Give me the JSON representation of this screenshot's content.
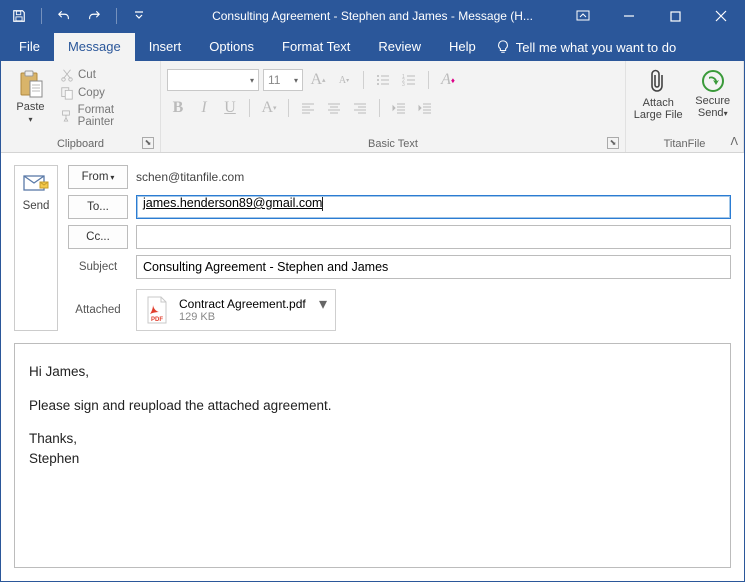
{
  "window": {
    "title": "Consulting Agreement - Stephen and James  -  Message (H..."
  },
  "tabs": {
    "file": "File",
    "message": "Message",
    "insert": "Insert",
    "options": "Options",
    "format": "Format Text",
    "review": "Review",
    "help": "Help",
    "tell": "Tell me what you want to do"
  },
  "ribbon": {
    "paste": "Paste",
    "cut": "Cut",
    "copy": "Copy",
    "painter": "Format Painter",
    "clipboard": "Clipboard",
    "font_name_placeholder": "",
    "font_size": "11",
    "basic_text": "Basic Text",
    "attach_big": "Attach Large File",
    "secure": "Secure Send",
    "titanfile": "TitanFile"
  },
  "compose": {
    "send": "Send",
    "from_btn": "From",
    "from_addr": "schen@titanfile.com",
    "to_btn": "To...",
    "to_value": "james.henderson89@gmail.com",
    "cc_btn": "Cc...",
    "cc_value": "",
    "subject_label": "Subject",
    "subject_value": "Consulting Agreement - Stephen and James",
    "attached_label": "Attached",
    "attachment_name": "Contract Agreement.pdf",
    "attachment_size": "129 KB"
  },
  "body": {
    "l1": "Hi James,",
    "l2": "Please sign and reupload the attached agreement.",
    "l3": "Thanks,",
    "l4": "Stephen"
  }
}
